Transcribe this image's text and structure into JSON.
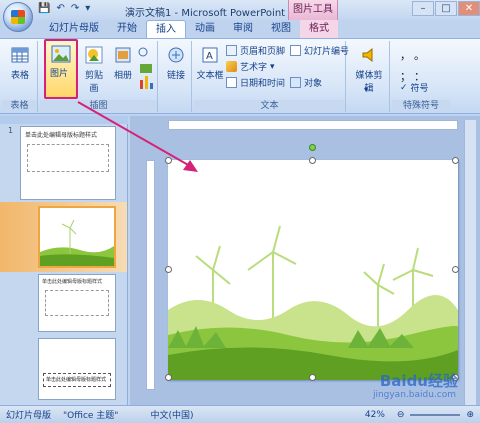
{
  "titlebar": {
    "title": "演示文稿1 - Microsoft PowerPoint",
    "context_tab": "图片工具",
    "qat_save": "💾",
    "qat_undo": "↶",
    "qat_redo": "↷",
    "qat_more": "▾",
    "min": "–",
    "max": "□",
    "close": "✕"
  },
  "tabs": [
    "幻灯片母版",
    "开始",
    "插入",
    "动画",
    "审阅",
    "视图",
    "格式"
  ],
  "active_tab": "插入",
  "ribbon": {
    "table": {
      "btn": "表格",
      "group": "表格"
    },
    "illustrations": {
      "picture": "图片",
      "clipart": "剪贴画",
      "album": "相册",
      "group": "插图"
    },
    "links": {
      "btn": "链接"
    },
    "text": {
      "textbox": "文本框",
      "header_footer": "页眉和页脚",
      "wordart": "艺术字",
      "wordart_arrow": "▾",
      "datetime": "日期和时间",
      "slide_number": "幻灯片编号",
      "object": "对象",
      "group": "文本"
    },
    "media": {
      "btn": "媒体剪辑",
      "group_glyph": "▾"
    },
    "symbols": {
      "special": "符号",
      "group": "特殊符号",
      "sym1": "，",
      "sym2": "。",
      "sym3": "；",
      "sym4": "："
    }
  },
  "colors": {
    "accent": "#d6217a",
    "ribbon_bg": "#d5e4f7",
    "selected_thumb": "#f7b35c"
  },
  "thumbnails": [
    {
      "num": "1",
      "title": "单击此处编辑母版标题样式"
    },
    {
      "num": "",
      "title": ""
    },
    {
      "num": "",
      "title": "单击此处编辑母版标题样式"
    },
    {
      "num": "",
      "title": "单击此处编辑母版标题样式"
    }
  ],
  "status": {
    "view": "幻灯片母版",
    "theme": "\"Office 主题\"",
    "lang": "中文(中国)",
    "zoom": "42%",
    "minus": "⊖",
    "plus": "⊕"
  },
  "watermark": {
    "logo": "Baidu经验",
    "url": "jingyan.baidu.com"
  }
}
